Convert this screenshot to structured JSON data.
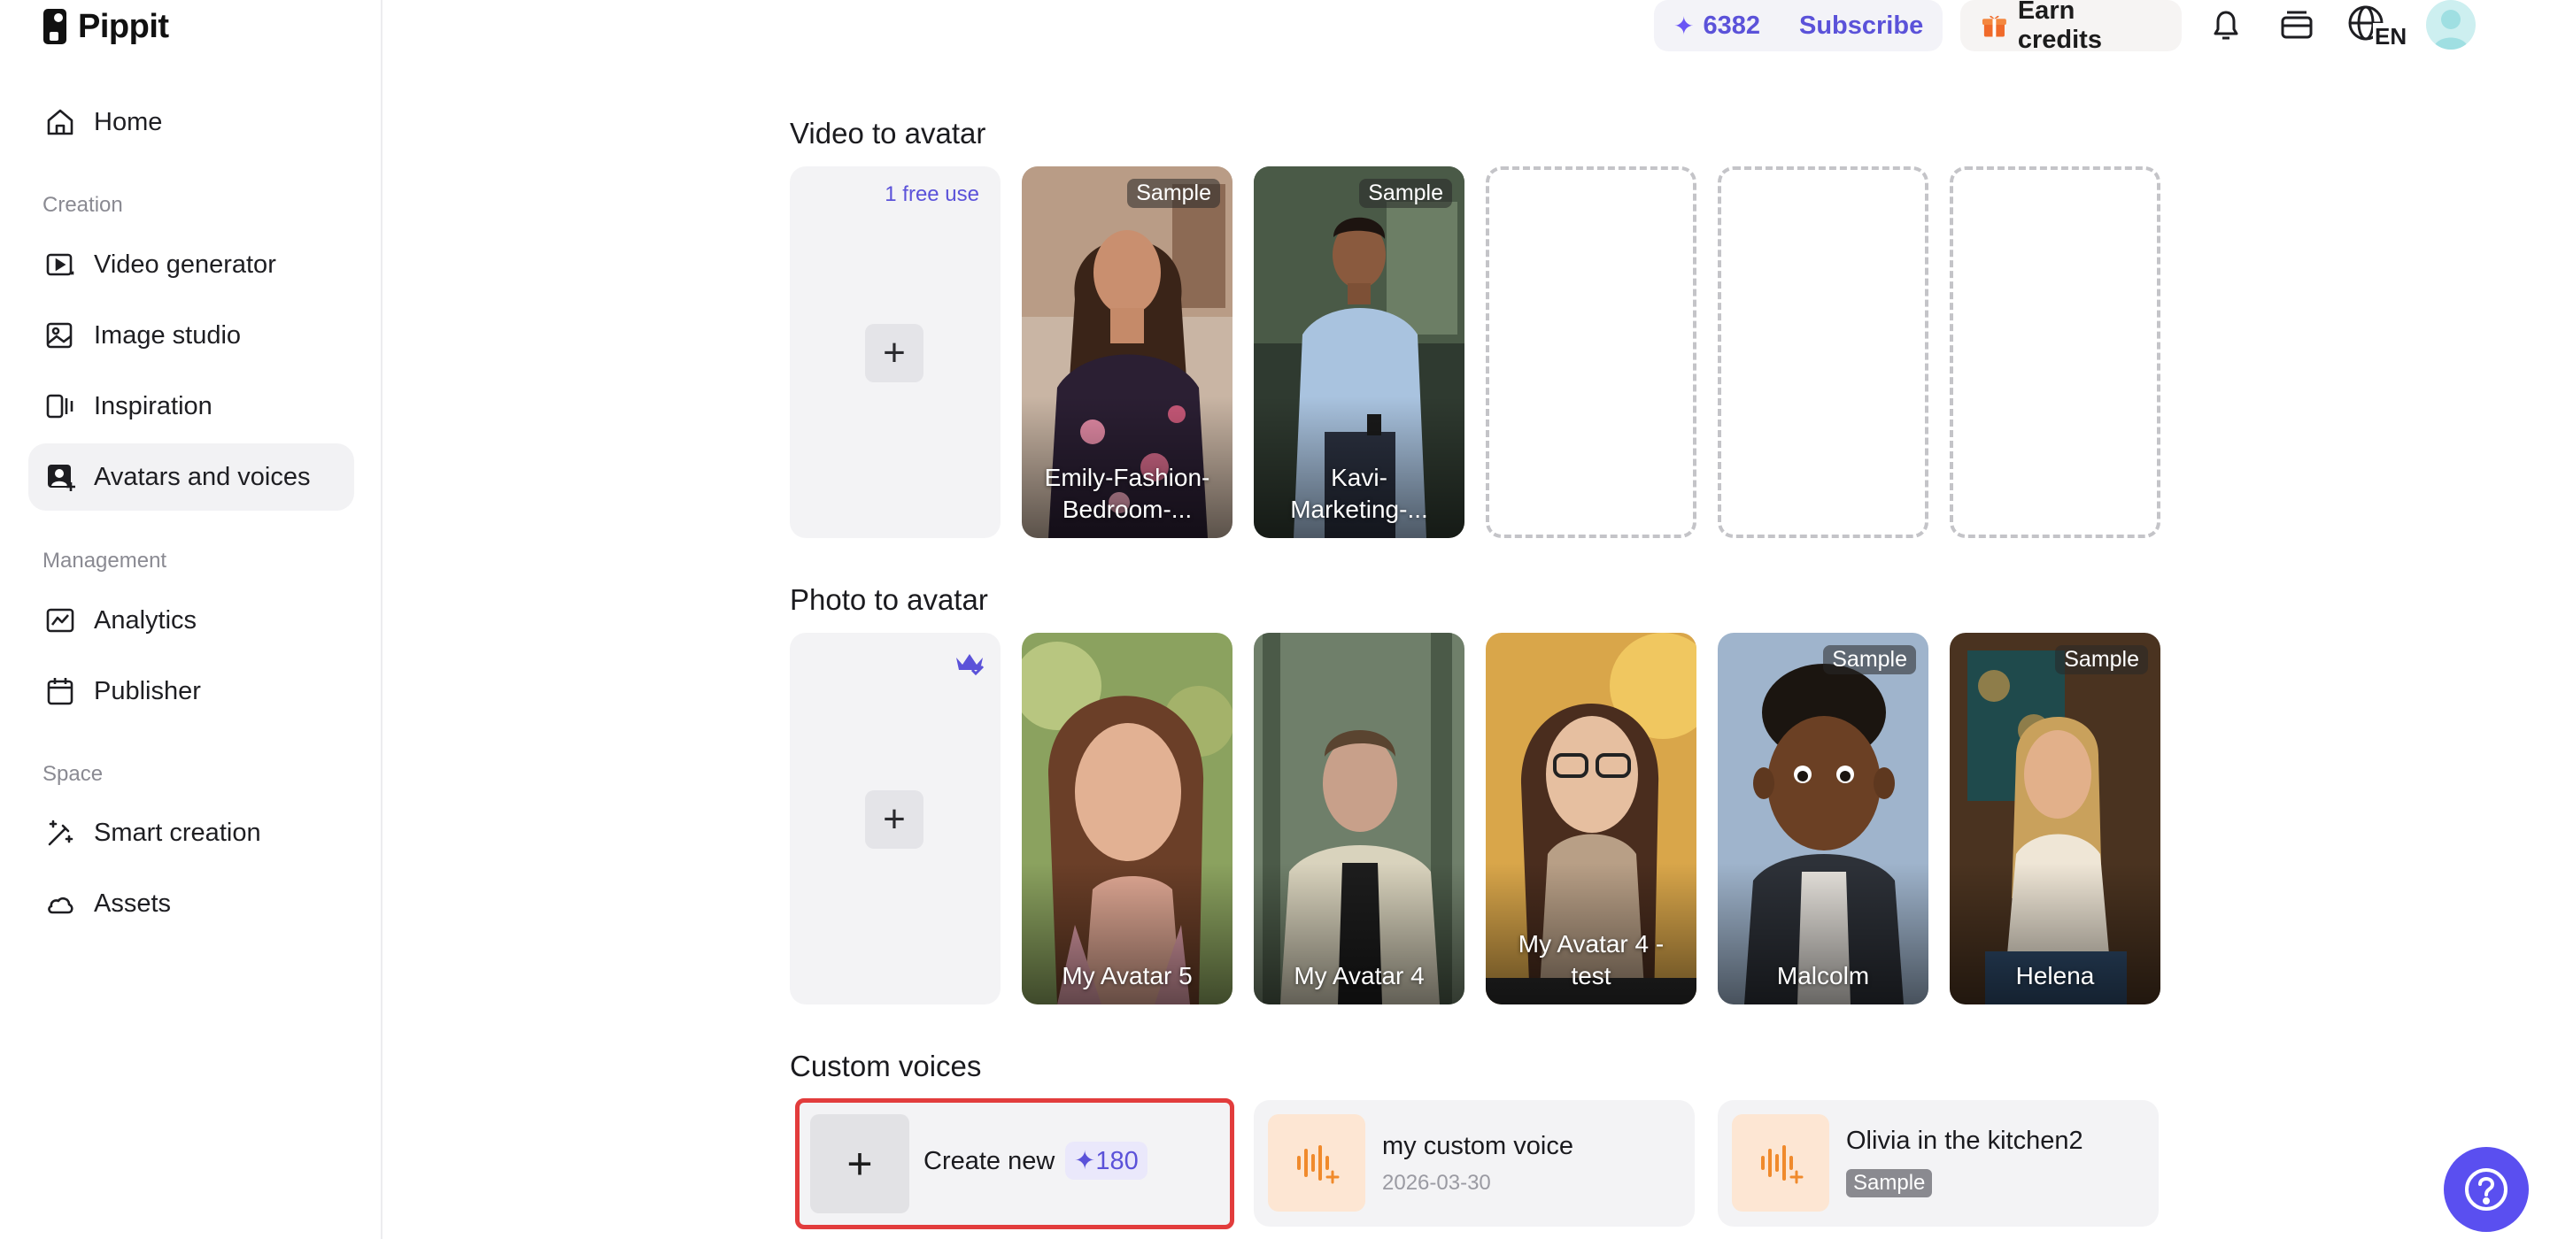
{
  "app": {
    "name": "Pippit"
  },
  "sidebar": {
    "home": "Home",
    "sections": {
      "creation": "Creation",
      "management": "Management",
      "space": "Space"
    },
    "items": [
      {
        "label": "Video generator"
      },
      {
        "label": "Image studio"
      },
      {
        "label": "Inspiration"
      },
      {
        "label": "Avatars and voices",
        "active": true
      },
      {
        "label": "Analytics"
      },
      {
        "label": "Publisher"
      },
      {
        "label": "Smart creation"
      },
      {
        "label": "Assets"
      }
    ]
  },
  "topbar": {
    "credits": "6382",
    "subscribe": "Subscribe",
    "earn_credits": "Earn credits",
    "language": "EN"
  },
  "video_to_avatar": {
    "title": "Video to avatar",
    "free_use": "1 free use",
    "cards": [
      {
        "label": "Emily-Fashion-Bedroom-...",
        "badge": "Sample"
      },
      {
        "label": "Kavi-Marketing-...",
        "badge": "Sample"
      }
    ]
  },
  "photo_to_avatar": {
    "title": "Photo to avatar",
    "cards": [
      {
        "label": "My Avatar 5",
        "badge": ""
      },
      {
        "label": "My Avatar 4",
        "badge": ""
      },
      {
        "label": "My Avatar 4 - test",
        "badge": ""
      },
      {
        "label": "Malcolm",
        "badge": "Sample"
      },
      {
        "label": "Helena",
        "badge": "Sample"
      }
    ]
  },
  "custom_voices": {
    "title": "Custom voices",
    "create_new": "Create new",
    "create_cost": "180",
    "voices": [
      {
        "name": "my custom voice",
        "date": "2026-03-30"
      },
      {
        "name": "Olivia in the kitchen2",
        "badge": "Sample"
      }
    ]
  },
  "colors": {
    "accent": "#5b52d9",
    "highlight_border": "#e23c3c",
    "voice_icon_bg": "#fde6d3",
    "voice_icon": "#f08a2c"
  }
}
